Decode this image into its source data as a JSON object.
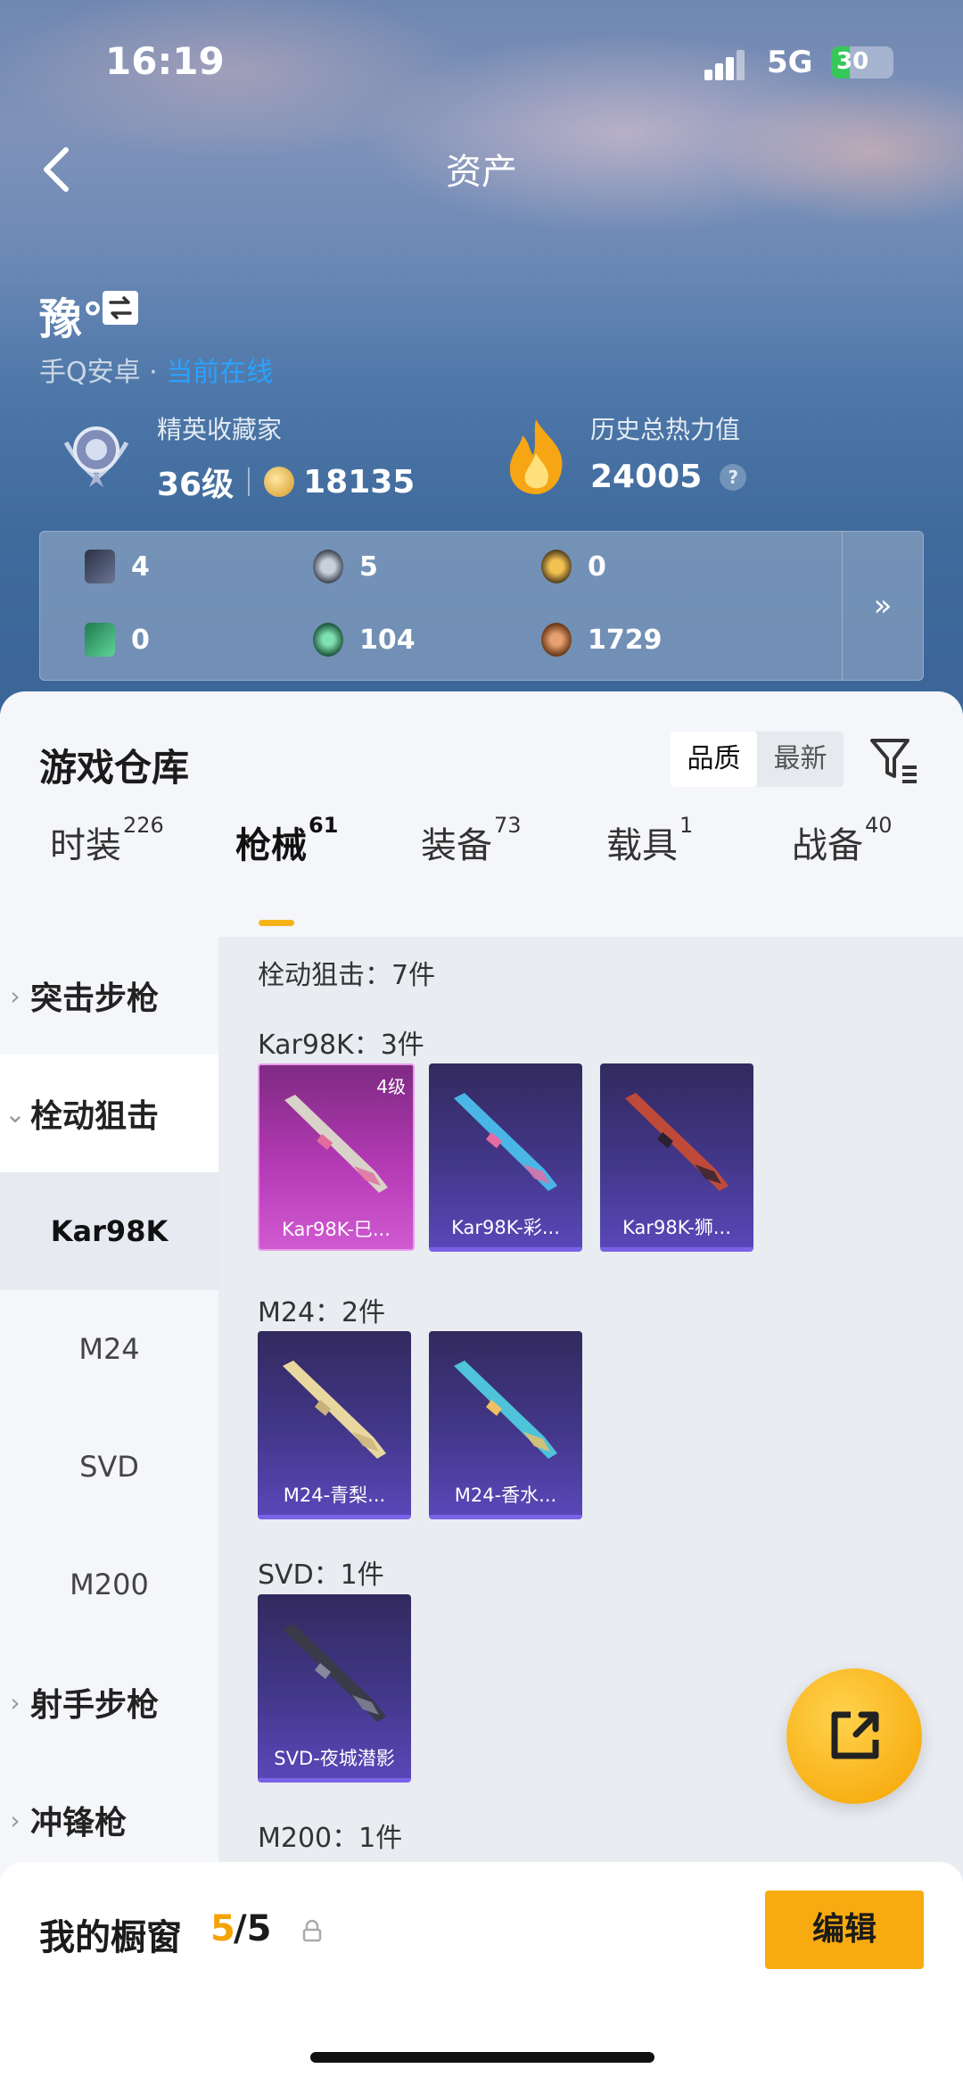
{
  "status": {
    "time": "16:19",
    "network": "5G",
    "battery": "30",
    "battery_level": 0.3
  },
  "header": {
    "title": "资产"
  },
  "profile": {
    "username": "豫°",
    "platform": "手Q安卓 · ",
    "online_status": "当前在线",
    "collector_label": "精英收藏家",
    "level": "36级",
    "coins": "18135",
    "heat_label": "历史总热力值",
    "heat_value": "24005",
    "help": "?"
  },
  "resources": [
    {
      "value": "4",
      "icon": "card-icon"
    },
    {
      "value": "5",
      "icon": "silver-coin-icon"
    },
    {
      "value": "0",
      "icon": "gold-coin-icon"
    },
    {
      "value": "0",
      "icon": "green-card-icon"
    },
    {
      "value": "104",
      "icon": "green-orb-icon"
    },
    {
      "value": "1729",
      "icon": "bronze-coin-icon"
    }
  ],
  "resources_more": "»",
  "warehouse": {
    "title": "游戏仓库",
    "sort_options": [
      "品质",
      "最新"
    ],
    "sort_selected": "品质"
  },
  "tabs": [
    {
      "label": "时装",
      "count": "226"
    },
    {
      "label": "枪械",
      "count": "61",
      "active": true
    },
    {
      "label": "装备",
      "count": "73"
    },
    {
      "label": "载具",
      "count": "1"
    },
    {
      "label": "战备",
      "count": "40"
    }
  ],
  "sidebar": [
    {
      "label": "突击步枪",
      "chevron": "›",
      "type": "group"
    },
    {
      "label": "栓动狙击",
      "chevron": "⌄",
      "type": "group"
    },
    {
      "label": "Kar98K",
      "type": "sub",
      "selected": true
    },
    {
      "label": "M24",
      "type": "sub"
    },
    {
      "label": "SVD",
      "type": "sub"
    },
    {
      "label": "M200",
      "type": "sub"
    },
    {
      "label": "射手步枪",
      "chevron": "›",
      "type": "group"
    },
    {
      "label": "冲锋枪",
      "chevron": "›",
      "type": "group"
    }
  ],
  "content": {
    "category_count": "栓动狙击：7件",
    "groups": [
      {
        "label": "Kar98K：3件",
        "items": [
          {
            "name": "Kar98K-巳...",
            "level": "4级",
            "style": "pink",
            "gun": "#d8d2c8",
            "accent": "#e26a9d"
          },
          {
            "name": "Kar98K-彩...",
            "level": "",
            "style": "purple",
            "gun": "#49b6e6",
            "accent": "#e86aa2"
          },
          {
            "name": "Kar98K-狮...",
            "level": "",
            "style": "purple",
            "gun": "#c04a3a",
            "accent": "#2a2030"
          }
        ]
      },
      {
        "label": "M24：2件",
        "items": [
          {
            "name": "M24-青梨...",
            "level": "",
            "style": "purple",
            "gun": "#e9d7a0",
            "accent": "#c9b27a"
          },
          {
            "name": "M24-香水...",
            "level": "",
            "style": "purple",
            "gun": "#4ec3d9",
            "accent": "#f0c060"
          }
        ]
      },
      {
        "label": "SVD：1件",
        "items": [
          {
            "name": "SVD-夜城潜影",
            "level": "",
            "style": "purple",
            "gun": "#3a3a48",
            "accent": "#8888a0"
          }
        ]
      },
      {
        "label": "M200：1件",
        "items": []
      }
    ]
  },
  "showcase": {
    "label": "我的橱窗",
    "count": "5",
    "total": "/5",
    "edit_label": "编辑"
  }
}
